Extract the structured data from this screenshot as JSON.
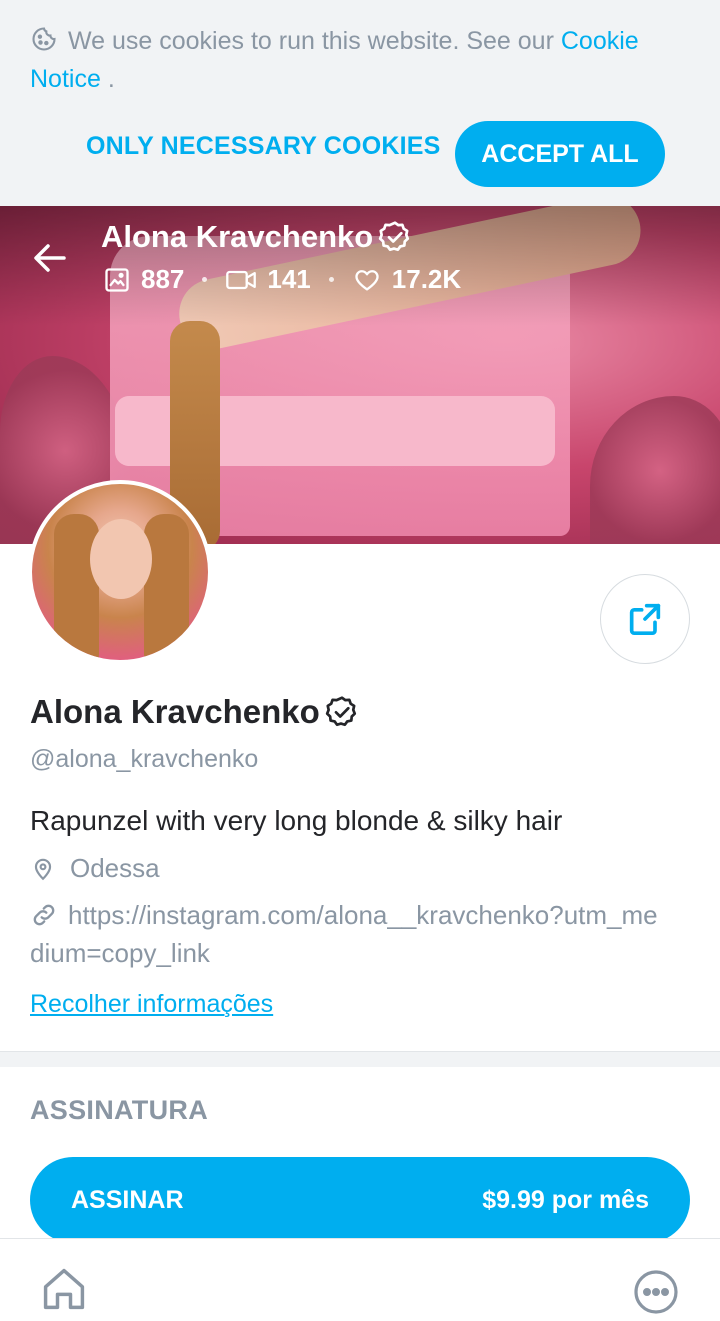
{
  "cookie": {
    "text": "We use cookies to run this website. See our",
    "link": "Cookie Notice",
    "suffix": " .",
    "only_necessary": "ONLY NECESSARY COOKIES",
    "accept_all": "ACCEPT ALL"
  },
  "header": {
    "name": "Alona Kravchenko",
    "photos": "887",
    "videos": "141",
    "likes": "17.2K"
  },
  "profile": {
    "name": "Alona Kravchenko",
    "handle": "@alona_kravchenko",
    "bio": "Rapunzel with very long blonde & silky hair",
    "location": "Odessa",
    "link": "https://instagram.com/alona__kravchenko?utm_medium=copy_link",
    "collapse": "Recolher informações"
  },
  "subscription": {
    "title": "ASSINATURA",
    "button_label": "ASSINAR",
    "price": "$9.99 por mês"
  },
  "colors": {
    "accent": "#00aeef",
    "muted": "#8a96a3",
    "text": "#242529"
  }
}
